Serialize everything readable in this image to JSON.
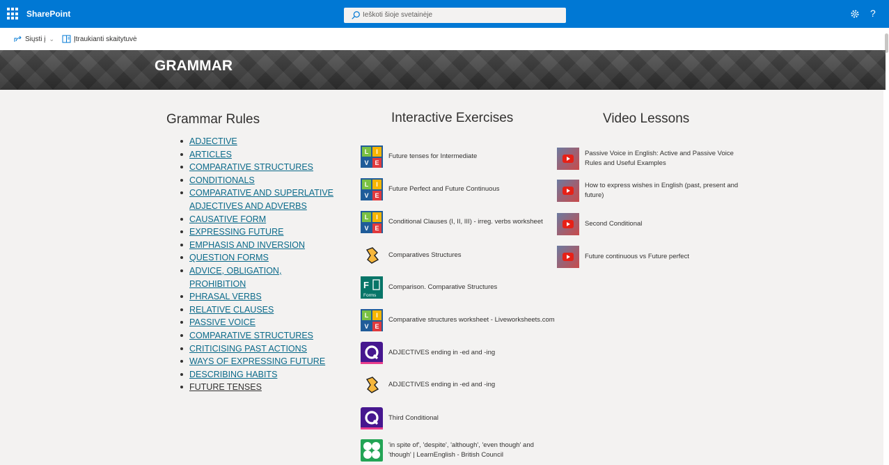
{
  "suitebar": {
    "brand": "SharePoint",
    "search_placeholder": "Ieškoti šioje svetainėje",
    "help": "?"
  },
  "commandbar": {
    "send_label": "Siųsti į",
    "reader_label": "Įtraukianti skaitytuvė"
  },
  "banner": {
    "title": "GRAMMAR"
  },
  "grammar_rules": {
    "title": "Grammar Rules",
    "items": [
      "ADJECTIVE",
      "ARTICLES",
      "COMPARATIVE STRUCTURES",
      "CONDITIONALS",
      "COMPARATIVE AND SUPERLATIVE ADJECTIVES AND ADVERBS",
      "CAUSATIVE FORM",
      "EXPRESSING FUTURE",
      "EMPHASIS AND INVERSION",
      "QUESTION FORMS",
      "ADVICE, OBLIGATION, PROHIBITION",
      "PHRASAL VERBS",
      "RELATIVE CLAUSES",
      "PASSIVE VOICE",
      "COMPARATIVE STRUCTURES",
      "CRITICISING PAST ACTIONS",
      "WAYS OF EXPRESSING FUTURE",
      "DESCRIBING HABITS",
      "FUTURE TENSES"
    ]
  },
  "interactive_exercises": {
    "title": "Interactive Exercises",
    "items": [
      {
        "label": "Future tenses for Intermediate",
        "icon": "liveworksheets-icon"
      },
      {
        "label": "Future Perfect and Future Continuous",
        "icon": "liveworksheets-icon"
      },
      {
        "label": "Conditional Clauses (I, II, III) - irreg. verbs worksheet",
        "icon": "liveworksheets-icon"
      },
      {
        "label": "Comparatives Structures",
        "icon": "wordwall-icon"
      },
      {
        "label": "Comparison. Comparative Structures",
        "icon": "ms-forms-icon"
      },
      {
        "label": "Comparative structures worksheet - Liveworksheets.com",
        "icon": "liveworksheets-icon"
      },
      {
        "label": "ADJECTIVES ending in -ed and -ing",
        "icon": "quizizz-icon"
      },
      {
        "label": "ADJECTIVES ending in -ed and -ing",
        "icon": "wordwall-icon"
      },
      {
        "label": "Third Conditional",
        "icon": "quizizz-icon"
      },
      {
        "label": "'in spite of', 'despite', 'although', 'even though' and 'though' | LearnEnglish - British Council",
        "icon": "learnenglish-icon"
      }
    ]
  },
  "video_lessons": {
    "title": "Video Lessons",
    "items": [
      {
        "label": "Passive Voice in English: Active and Passive Voice Rules and Useful Examples"
      },
      {
        "label": "How to express wishes in English (past, present and future)"
      },
      {
        "label": "Second Conditional"
      },
      {
        "label": "Future continuous vs Future perfect"
      }
    ]
  },
  "colors": {
    "suitebar": "#0078d4",
    "link": "#0b6a8a",
    "page_bg": "#f3f2f1"
  }
}
